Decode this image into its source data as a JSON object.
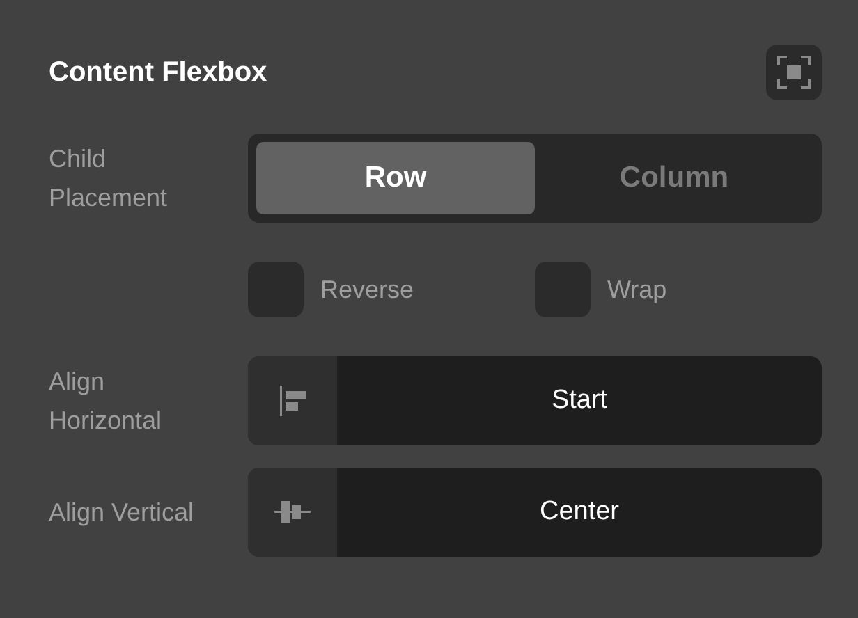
{
  "panel": {
    "title": "Content Flexbox"
  },
  "child_placement": {
    "label": "Child Placement",
    "options": [
      {
        "label": "Row",
        "selected": true
      },
      {
        "label": "Column",
        "selected": false
      }
    ]
  },
  "checkboxes": [
    {
      "label": "Reverse",
      "checked": false
    },
    {
      "label": "Wrap",
      "checked": false
    }
  ],
  "alignments": [
    {
      "label": "Align Horizontal",
      "value": "Start",
      "kind": "horizontal"
    },
    {
      "label": "Align Vertical",
      "value": "Center",
      "kind": "vertical"
    }
  ]
}
